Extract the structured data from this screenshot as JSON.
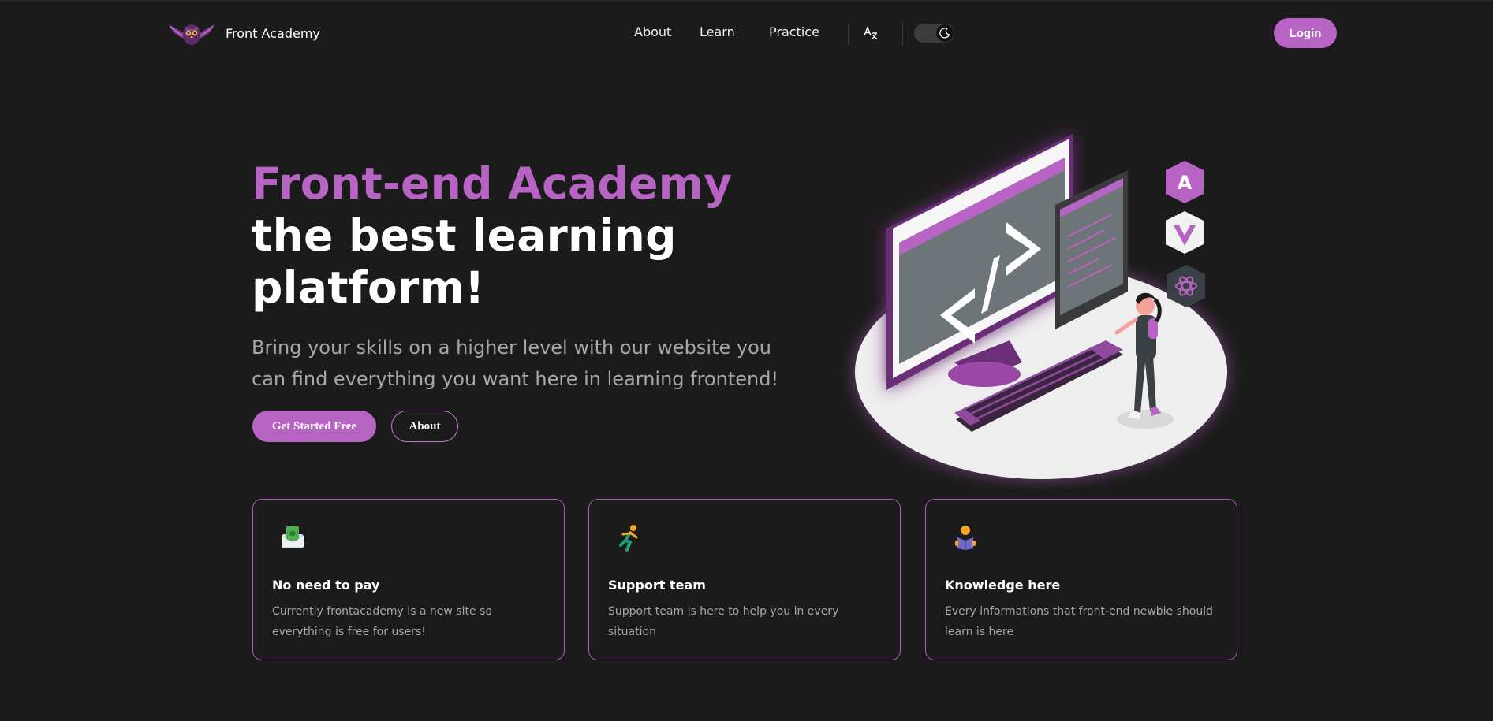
{
  "header": {
    "brand_name": "Front Academy",
    "nav": [
      {
        "label": "About"
      },
      {
        "label": "Learn"
      },
      {
        "label": "Practice"
      }
    ],
    "login_label": "Login"
  },
  "hero": {
    "title_accent": "Front-end Academy",
    "title_rest": "the best learning platform!",
    "subtitle": "Bring your skills on a higher level with our website you can find everything you want here in learning frontend!",
    "primary_button": "Get Started Free",
    "secondary_button": "About",
    "code_symbol": "</>"
  },
  "features": [
    {
      "title": "No need to pay",
      "text": "Currently frontacademy is a new site so everything is free for users!",
      "icon": "money-envelope-icon"
    },
    {
      "title": "Support team",
      "text": "Support team is here to help you in every situation",
      "icon": "runner-icon"
    },
    {
      "title": "Knowledge here",
      "text": "Every informations that front-end newbie should learn is here",
      "icon": "reader-icon"
    }
  ],
  "colors": {
    "accent": "#b864c4",
    "background": "#1c1b1c",
    "muted_text": "#a7a7a7"
  }
}
